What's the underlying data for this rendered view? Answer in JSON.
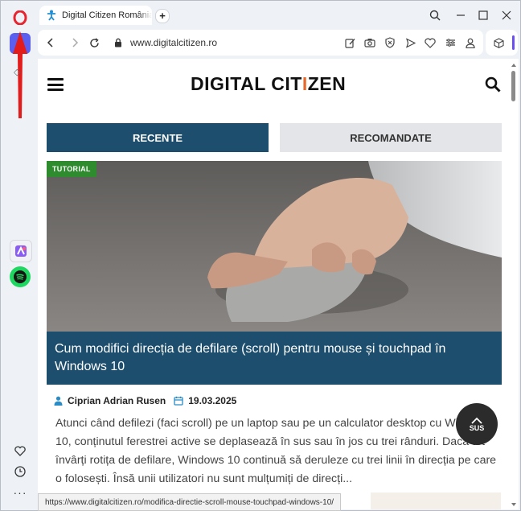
{
  "tab": {
    "title": "Digital Citizen România - \\"
  },
  "address_bar": {
    "url": "www.digitalcitizen.ro"
  },
  "site": {
    "logo_prefix": "DIGITAL CIT",
    "logo_i": "I",
    "logo_suffix": "ZEN",
    "tabs": [
      {
        "label": "RECENTE"
      },
      {
        "label": "RECOMANDATE"
      }
    ]
  },
  "article": {
    "category": "TUTORIAL",
    "title": "Cum modifici direcția de defilare (scroll) pentru mouse și touchpad în Windows 10",
    "author": "Ciprian Adrian Rusen",
    "date": "19.03.2025",
    "excerpt": "Atunci când defilezi (faci scroll) pe un laptop sau pe un calculator desktop cu Windows 10, conținutul ferestrei active se deplasează în sus sau în jos cu trei rânduri. Dacă tot învârți rotița de defilare, Windows 10 continuă să deruleze cu trei linii în direcția pe care o folosești. Însă unii utilizatori nu sunt mulțumiți de direcți..."
  },
  "back_to_top": {
    "label": "SUS"
  },
  "status_bar": {
    "url": "https://www.digitalcitizen.ro/modifica-directie-scroll-mouse-touchpad-windows-10/"
  },
  "colors": {
    "brand_dark": "#1d4e6d",
    "badge_green": "#2e8b2e",
    "logo_accent": "#e8692b",
    "opera_red": "#e8242f",
    "annotation_red": "#e21b1b"
  }
}
